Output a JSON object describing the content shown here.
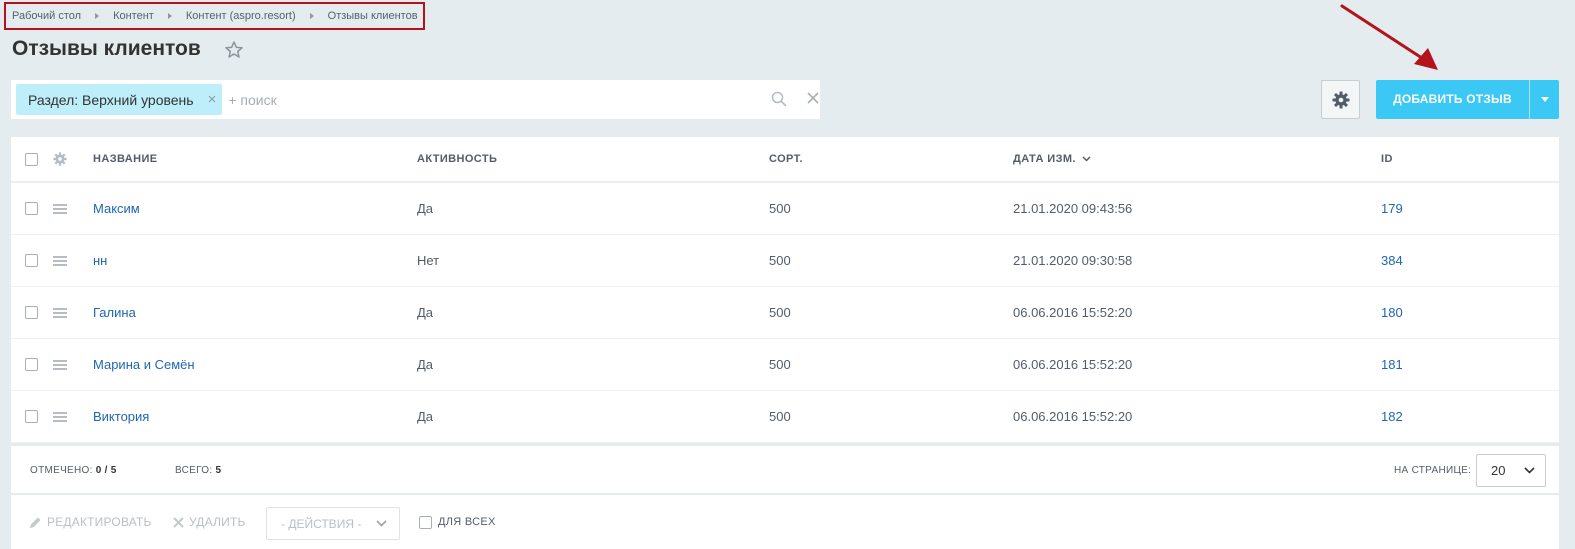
{
  "breadcrumb": [
    "Рабочий стол",
    "Контент",
    "Контент (aspro.resort)",
    "Отзывы клиентов"
  ],
  "page_title": "Отзывы клиентов",
  "filter": {
    "chip_label": "Раздел: Верхний уровень",
    "chip_remove": "×",
    "search_placeholder": "+ поиск"
  },
  "add_button": {
    "label": "ДОБАВИТЬ ОТЗЫВ"
  },
  "grid": {
    "columns": {
      "name": "НАЗВАНИЕ",
      "active": "АКТИВНОСТЬ",
      "sort": "СОРТ.",
      "date": "ДАТА ИЗМ.",
      "id": "ID"
    },
    "rows": [
      {
        "name": "Максим",
        "active": "Да",
        "sort": "500",
        "date": "21.01.2020 09:43:56",
        "id": "179"
      },
      {
        "name": "нн",
        "active": "Нет",
        "sort": "500",
        "date": "21.01.2020 09:30:58",
        "id": "384"
      },
      {
        "name": "Галина",
        "active": "Да",
        "sort": "500",
        "date": "06.06.2016 15:52:20",
        "id": "180"
      },
      {
        "name": "Марина и Семён",
        "active": "Да",
        "sort": "500",
        "date": "06.06.2016 15:52:20",
        "id": "181"
      },
      {
        "name": "Виктория",
        "active": "Да",
        "sort": "500",
        "date": "06.06.2016 15:52:20",
        "id": "182"
      }
    ]
  },
  "footer": {
    "marked_label": "ОТМЕЧЕНО:",
    "marked_value": "0 / 5",
    "total_label": "ВСЕГО:",
    "total_value": "5",
    "per_page_label": "НА СТРАНИЦЕ:",
    "per_page_value": "20"
  },
  "actions": {
    "edit": "РЕДАКТИРОВАТЬ",
    "delete": "УДАЛИТЬ",
    "select": "- ДЕЙСТВИЯ -",
    "for_all": "ДЛЯ ВСЕХ"
  },
  "colors": {
    "accent": "#3bc8f5",
    "chip": "#bdeefa",
    "link": "#2067b0",
    "annotation": "#b3141b"
  }
}
